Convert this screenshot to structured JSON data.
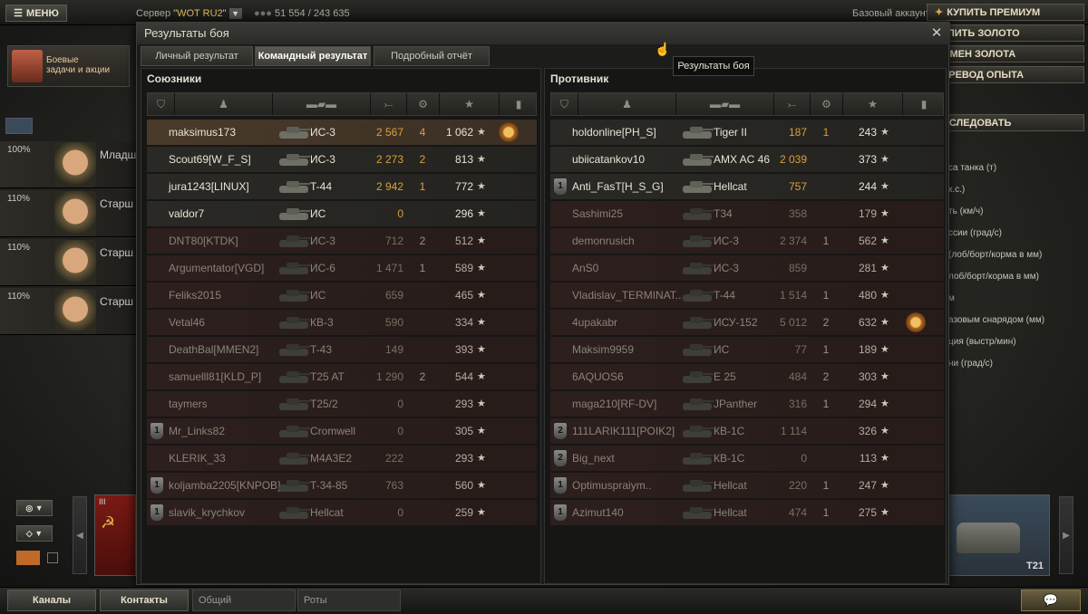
{
  "topbar": {
    "menu_label": "МЕНЮ",
    "server_prefix": "Сервер",
    "server_name": "\"WOT RU2\"",
    "online_count": "51 554 / 243 635",
    "account_type": "Базовый аккаунт",
    "buy_premium": "КУПИТЬ ПРЕМИУМ",
    "buy_gold": "КУПИТЬ ЗОЛОТО",
    "exchange_gold": "ОБМЕН ЗОЛОТА",
    "transfer_xp": "ПЕРЕВОД ОПЫТА",
    "research": "ИССЛЕДОВАТЬ"
  },
  "left": {
    "missions_label_1": "Боевые",
    "missions_label_2": "задачи и акции",
    "crew": [
      {
        "percent": "100%",
        "rank": "Младш"
      },
      {
        "percent": "110%",
        "rank": "Старш"
      },
      {
        "percent": "110%",
        "rank": "Старш"
      },
      {
        "percent": "110%",
        "rank": "Старш"
      }
    ]
  },
  "right_stats": [
    "са танка (т)",
    "к.с.)",
    "ть (км/ч)",
    "ссии (град/с)",
    "(лоб/борт/корма в мм)",
    "лоб/борт/корма в мм)",
    "м",
    "азовым снарядом (мм)",
    "ция (выстр/мин)",
    "ни (град/с)"
  ],
  "carousel": {
    "tank_name": "T21",
    "tier": "III"
  },
  "dialog": {
    "title": "Результаты боя",
    "tabs": [
      "Личный результат",
      "Командный результат",
      "Подробный отчёт"
    ],
    "tooltip": "Результаты боя",
    "allies_title": "Союзники",
    "enemies_title": "Противник"
  },
  "allies": [
    {
      "name": "maksimus173",
      "tank": "ИС-3",
      "damage": "2 567",
      "kills": "4",
      "xp": "1 062",
      "status": "me",
      "medal": true
    },
    {
      "name": "Scout69[W_F_S]",
      "tank": "ИС-3",
      "damage": "2 273",
      "kills": "2",
      "xp": "813",
      "status": "alive"
    },
    {
      "name": "jura1243[LINUX]",
      "tank": "T-44",
      "damage": "2 942",
      "kills": "1",
      "xp": "772",
      "status": "alive"
    },
    {
      "name": "valdor7",
      "tank": "ИС",
      "damage": "0",
      "kills": "",
      "xp": "296",
      "status": "alive"
    },
    {
      "name": "DNT80[KTDK]",
      "tank": "ИС-3",
      "damage": "712",
      "kills": "2",
      "xp": "512",
      "status": "dead"
    },
    {
      "name": "Argumentator[VGD]",
      "tank": "ИС-6",
      "damage": "1 471",
      "kills": "1",
      "xp": "589",
      "status": "dead"
    },
    {
      "name": "Feliks2015",
      "tank": "ИС",
      "damage": "659",
      "kills": "",
      "xp": "465",
      "status": "dead"
    },
    {
      "name": "Vetal46",
      "tank": "КВ-3",
      "damage": "590",
      "kills": "",
      "xp": "334",
      "status": "dead"
    },
    {
      "name": "DeathBal[MMEN2]",
      "tank": "T-43",
      "damage": "149",
      "kills": "",
      "xp": "393",
      "status": "dead"
    },
    {
      "name": "samuelll81[KLD_P]",
      "tank": "T25 AT",
      "damage": "1 290",
      "kills": "2",
      "xp": "544",
      "status": "dead"
    },
    {
      "name": "taymers",
      "tank": "T25/2",
      "damage": "0",
      "kills": "",
      "xp": "293",
      "status": "dead"
    },
    {
      "name": "Mr_Links82",
      "tank": "Cromwell",
      "damage": "0",
      "kills": "",
      "xp": "305",
      "status": "dead",
      "platoon": "1"
    },
    {
      "name": "KLERIK_33",
      "tank": "M4A3E2",
      "damage": "222",
      "kills": "",
      "xp": "293",
      "status": "dead"
    },
    {
      "name": "koljamba2205[KNPOB]",
      "tank": "T-34-85",
      "damage": "763",
      "kills": "",
      "xp": "560",
      "status": "dead",
      "platoon": "1"
    },
    {
      "name": "slavik_krychkov",
      "tank": "Hellcat",
      "damage": "0",
      "kills": "",
      "xp": "259",
      "status": "dead",
      "platoon": "1"
    }
  ],
  "enemies": [
    {
      "name": "holdonline[PH_S]",
      "tank": "Tiger II",
      "damage": "187",
      "kills": "1",
      "xp": "243",
      "status": "alive"
    },
    {
      "name": "ubiicatankov10",
      "tank": "AMX AC 46",
      "damage": "2 039",
      "kills": "",
      "xp": "373",
      "status": "alive"
    },
    {
      "name": "Anti_FasT[H_S_G]",
      "tank": "Hellcat",
      "damage": "757",
      "kills": "",
      "xp": "244",
      "status": "alive",
      "platoon": "1"
    },
    {
      "name": "Sashimi25",
      "tank": "T34",
      "damage": "358",
      "kills": "",
      "xp": "179",
      "status": "dead"
    },
    {
      "name": "demonrusich",
      "tank": "ИС-3",
      "damage": "2 374",
      "kills": "1",
      "xp": "562",
      "status": "dead"
    },
    {
      "name": "AnS0",
      "tank": "ИС-3",
      "damage": "859",
      "kills": "",
      "xp": "281",
      "status": "dead"
    },
    {
      "name": "Vladislav_TERMINAT..",
      "tank": "T-44",
      "damage": "1 514",
      "kills": "1",
      "xp": "480",
      "status": "dead"
    },
    {
      "name": "4upakabr",
      "tank": "ИСУ-152",
      "damage": "5 012",
      "kills": "2",
      "xp": "632",
      "status": "dead",
      "medal": true
    },
    {
      "name": "Maksim9959",
      "tank": "ИС",
      "damage": "77",
      "kills": "1",
      "xp": "189",
      "status": "dead"
    },
    {
      "name": "6AQUOS6",
      "tank": "E 25",
      "damage": "484",
      "kills": "2",
      "xp": "303",
      "status": "dead"
    },
    {
      "name": "maga210[RF-DV]",
      "tank": "JPanther",
      "damage": "316",
      "kills": "1",
      "xp": "294",
      "status": "dead"
    },
    {
      "name": "111LARIK111[POIK2]",
      "tank": "КВ-1С",
      "damage": "1 114",
      "kills": "",
      "xp": "326",
      "status": "dead",
      "platoon": "2"
    },
    {
      "name": "Big_next",
      "tank": "КВ-1С",
      "damage": "0",
      "kills": "",
      "xp": "113",
      "status": "dead",
      "platoon": "2"
    },
    {
      "name": "Optimuspraiym..",
      "tank": "Hellcat",
      "damage": "220",
      "kills": "1",
      "xp": "247",
      "status": "dead",
      "platoon": "1"
    },
    {
      "name": "Azimut140",
      "tank": "Hellcat",
      "damage": "474",
      "kills": "1",
      "xp": "275",
      "status": "dead",
      "platoon": "1"
    }
  ],
  "bottombar": {
    "channels": "Каналы",
    "contacts": "Контакты",
    "general": "Общий",
    "companies": "Роты"
  }
}
